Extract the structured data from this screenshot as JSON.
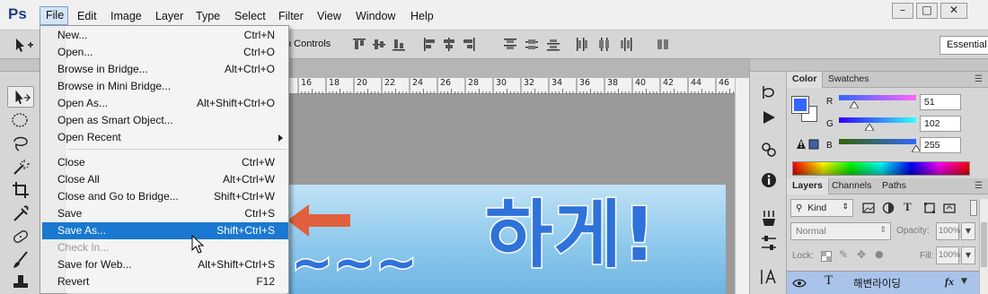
{
  "app": {
    "logo": "Ps"
  },
  "menubar": {
    "items": [
      "File",
      "Edit",
      "Image",
      "Layer",
      "Type",
      "Select",
      "Filter",
      "View",
      "Window",
      "Help"
    ],
    "window_controls": [
      "minimize-icon",
      "maximize-icon",
      "close-icon"
    ]
  },
  "options_bar": {
    "show_controls_label": "n Controls",
    "workspace": "Essential"
  },
  "file_menu": {
    "items": [
      {
        "label": "New...",
        "shortcut": "Ctrl+N"
      },
      {
        "label": "Open...",
        "shortcut": "Ctrl+O"
      },
      {
        "label": "Browse in Bridge...",
        "shortcut": "Alt+Ctrl+O"
      },
      {
        "label": "Browse in Mini Bridge...",
        "shortcut": ""
      },
      {
        "label": "Open As...",
        "shortcut": "Alt+Shift+Ctrl+O"
      },
      {
        "label": "Open as Smart Object...",
        "shortcut": ""
      },
      {
        "label": "Open Recent",
        "shortcut": ""
      },
      {
        "label": "Close",
        "shortcut": "Ctrl+W"
      },
      {
        "label": "Close All",
        "shortcut": "Alt+Ctrl+W"
      },
      {
        "label": "Close and Go to Bridge...",
        "shortcut": "Shift+Ctrl+W"
      },
      {
        "label": "Save",
        "shortcut": "Ctrl+S"
      },
      {
        "label": "Save As...",
        "shortcut": "Shift+Ctrl+S",
        "highlighted": true
      },
      {
        "label": "Check In...",
        "shortcut": "",
        "disabled": true
      },
      {
        "label": "Save for Web...",
        "shortcut": "Alt+Shift+Ctrl+S"
      },
      {
        "label": "Revert",
        "shortcut": "F12"
      }
    ]
  },
  "ruler": {
    "numbers": [
      "16",
      "18",
      "20",
      "22",
      "24",
      "26",
      "28",
      "30",
      "32",
      "34",
      "36",
      "38",
      "40",
      "42",
      "44",
      "46"
    ]
  },
  "canvas": {
    "image_text": "하게!",
    "tilde_text": "~~~"
  },
  "color_panel": {
    "tabs": [
      "Color",
      "Swatches"
    ],
    "channels": [
      {
        "label": "R",
        "value": "51",
        "fraction": 0.2
      },
      {
        "label": "G",
        "value": "102",
        "fraction": 0.4
      },
      {
        "label": "B",
        "value": "255",
        "fraction": 1.0
      }
    ],
    "foreground": "#3366ff",
    "background": "#ffffff"
  },
  "layers_panel": {
    "tabs": [
      "Layers",
      "Channels",
      "Paths"
    ],
    "filter_kind": "Kind",
    "blend_mode": "Normal",
    "opacity_label": "Opacity:",
    "opacity_value": "100%",
    "lock_label": "Lock:",
    "fill_label": "Fill:",
    "fill_value": "100%",
    "layer": {
      "type_icon": "T",
      "name": "해변라이딩",
      "fx": "fx"
    }
  }
}
